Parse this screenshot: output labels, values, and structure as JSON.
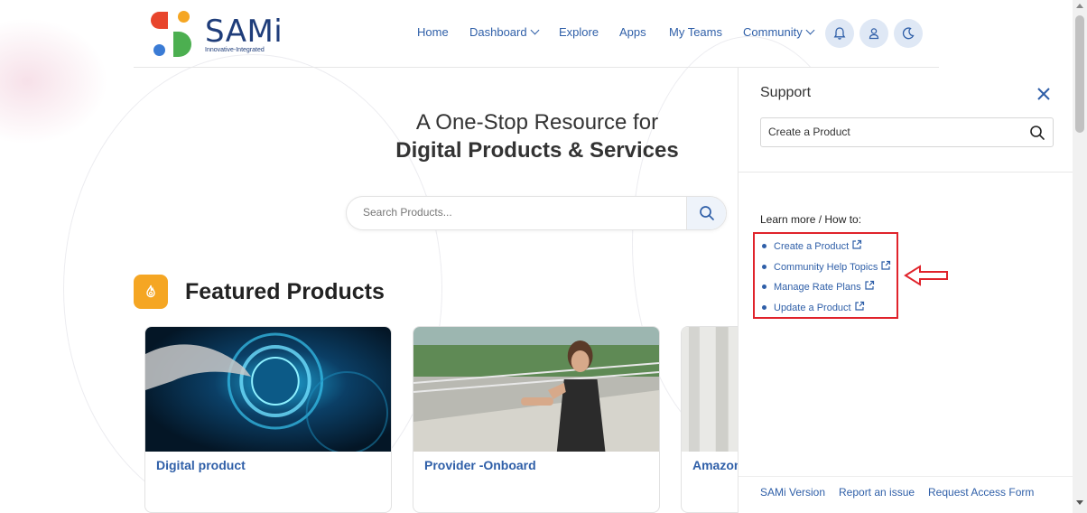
{
  "brand": {
    "name": "SAMi",
    "tagline": "Innovative-Integrated",
    "colors": {
      "red": "#e8452c",
      "orange": "#f5a623",
      "blue": "#3a7bd5",
      "green": "#4caf50",
      "navy": "#1f3d7a"
    }
  },
  "nav": {
    "items": [
      {
        "label": "Home",
        "has_dropdown": false
      },
      {
        "label": "Dashboard",
        "has_dropdown": true
      },
      {
        "label": "Explore",
        "has_dropdown": false
      },
      {
        "label": "Apps",
        "has_dropdown": false
      },
      {
        "label": "My Teams",
        "has_dropdown": false
      },
      {
        "label": "Community",
        "has_dropdown": true
      }
    ],
    "icons": [
      "bell-icon",
      "user-icon",
      "moon-icon"
    ]
  },
  "hero": {
    "line1": "A One-Stop Resource for",
    "line2": "Digital Products & Services",
    "search_placeholder": "Search Products..."
  },
  "featured": {
    "title": "Featured Products",
    "cards": [
      {
        "title": "Digital product"
      },
      {
        "title": "Provider -Onboard"
      },
      {
        "title": "Amazon"
      }
    ]
  },
  "support": {
    "title": "Support",
    "search_value": "Create a Product",
    "learn_heading": "Learn more / How to:",
    "links": [
      {
        "label": "Create a Product"
      },
      {
        "label": "Community Help Topics"
      },
      {
        "label": "Manage Rate Plans"
      },
      {
        "label": "Update a Product"
      }
    ],
    "footer": [
      "SAMi Version",
      "Report an issue",
      "Request Access Form"
    ],
    "highlight_color": "#e0232b"
  }
}
